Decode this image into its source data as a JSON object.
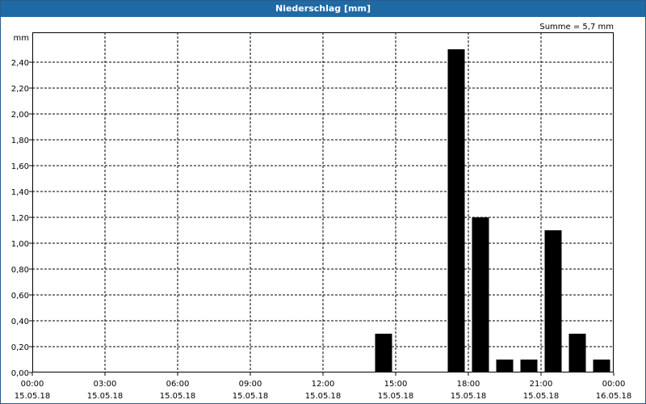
{
  "window": {
    "title": "Niederschlag [mm]"
  },
  "chart_data": {
    "type": "bar",
    "title": "Niederschlag [mm]",
    "ylabel": "mm",
    "summary": "Summe = 5,7 mm",
    "ylim": [
      0,
      2.6
    ],
    "yticks": [
      {
        "value": 0.0,
        "label": "0,00"
      },
      {
        "value": 0.2,
        "label": "0,20"
      },
      {
        "value": 0.4,
        "label": "0,40"
      },
      {
        "value": 0.6,
        "label": "0,60"
      },
      {
        "value": 0.8,
        "label": "0,80"
      },
      {
        "value": 1.0,
        "label": "1,00"
      },
      {
        "value": 1.2,
        "label": "1,20"
      },
      {
        "value": 1.4,
        "label": "1,40"
      },
      {
        "value": 1.6,
        "label": "1,60"
      },
      {
        "value": 1.8,
        "label": "1,80"
      },
      {
        "value": 2.0,
        "label": "2,00"
      },
      {
        "value": 2.2,
        "label": "2,20"
      },
      {
        "value": 2.4,
        "label": "2,40"
      }
    ],
    "xrange_hours": [
      0,
      24
    ],
    "xticks": [
      {
        "hour": 0,
        "time": "00:00",
        "date": "15.05.18"
      },
      {
        "hour": 3,
        "time": "03:00",
        "date": "15.05.18"
      },
      {
        "hour": 6,
        "time": "06:00",
        "date": "15.05.18"
      },
      {
        "hour": 9,
        "time": "09:00",
        "date": "15.05.18"
      },
      {
        "hour": 12,
        "time": "12:00",
        "date": "15.05.18"
      },
      {
        "hour": 15,
        "time": "15:00",
        "date": "15.05.18"
      },
      {
        "hour": 18,
        "time": "18:00",
        "date": "15.05.18"
      },
      {
        "hour": 21,
        "time": "21:00",
        "date": "15.05.18"
      },
      {
        "hour": 24,
        "time": "00:00",
        "date": "16.05.18"
      }
    ],
    "bars": [
      {
        "hour": 14.5,
        "value": 0.3
      },
      {
        "hour": 17.5,
        "value": 2.5
      },
      {
        "hour": 18.5,
        "value": 1.2
      },
      {
        "hour": 19.5,
        "value": 0.1
      },
      {
        "hour": 20.5,
        "value": 0.1
      },
      {
        "hour": 21.5,
        "value": 1.1
      },
      {
        "hour": 22.5,
        "value": 0.3
      },
      {
        "hour": 23.5,
        "value": 0.1
      }
    ],
    "grid": true,
    "bar_color": "#000000"
  }
}
